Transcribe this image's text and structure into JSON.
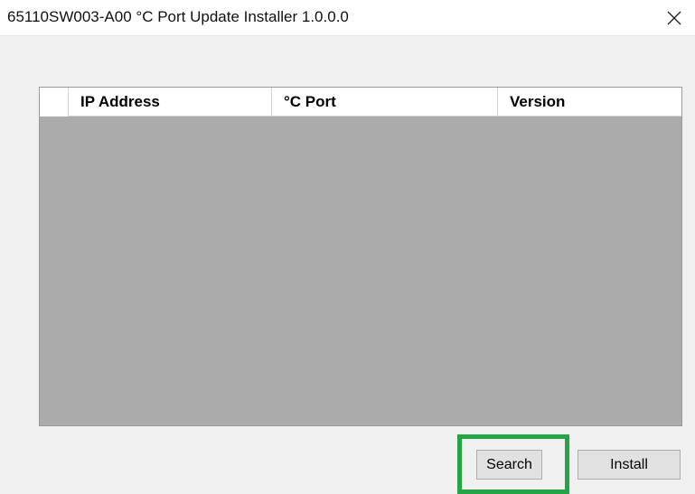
{
  "window": {
    "title": "65110SW003-A00 °C Port Update Installer 1.0.0.0",
    "close_icon": "close-icon"
  },
  "grid": {
    "columns": [
      "IP Address",
      "°C Port",
      "Version"
    ],
    "rows": []
  },
  "buttons": {
    "search_label": "Search",
    "install_label": "Install"
  },
  "colors": {
    "highlight": "#24a445",
    "grid_background": "#ababab",
    "window_background": "#f0f0f0"
  }
}
